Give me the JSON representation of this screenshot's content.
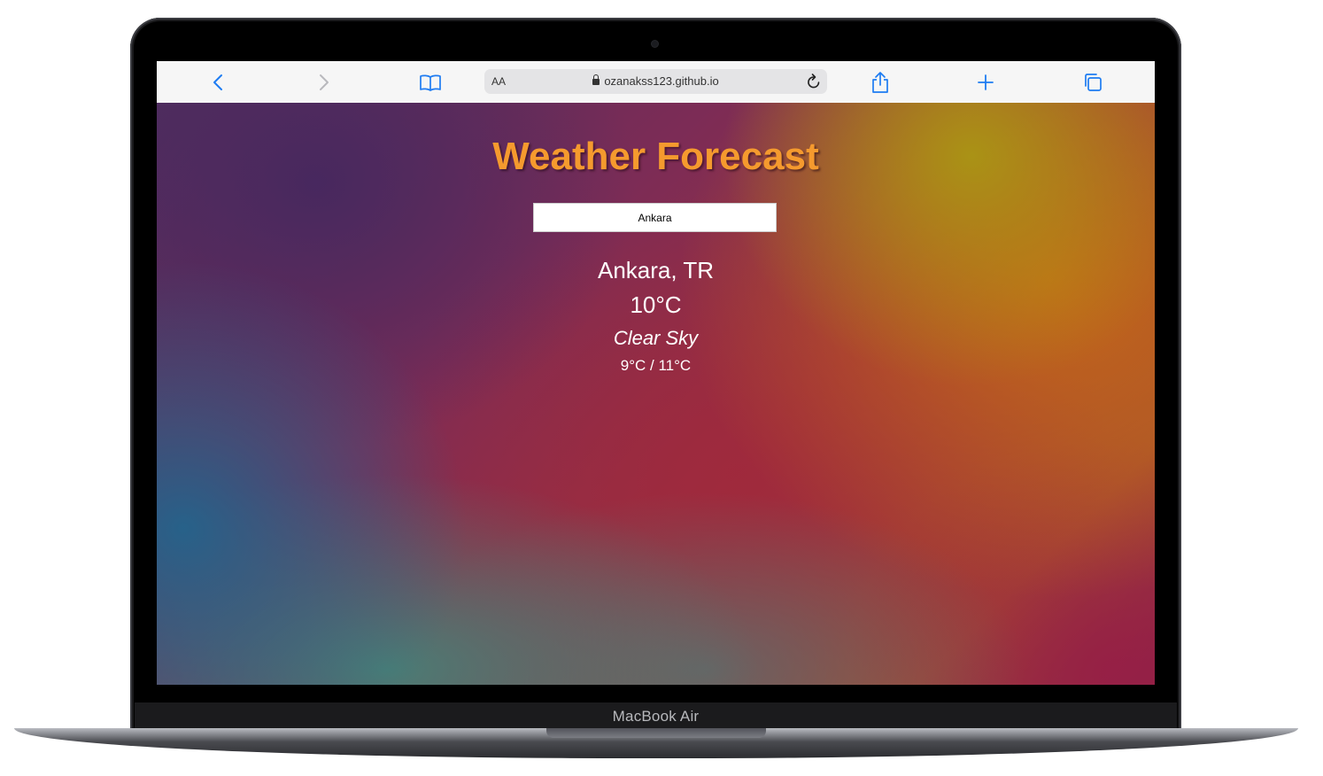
{
  "device": {
    "label": "MacBook Air"
  },
  "browser": {
    "reader_label": "AA",
    "url": "ozanakss123.github.io",
    "accent_color": "#1e7cf2",
    "icons": [
      "back-icon",
      "forward-icon",
      "bookmarks-icon",
      "lock-icon",
      "reload-icon",
      "share-icon",
      "new-tab-icon",
      "tabs-icon"
    ]
  },
  "page": {
    "title": "Weather Forecast",
    "search": {
      "value": "Ankara"
    },
    "weather": {
      "location": "Ankara, TR",
      "temperature": "10°C",
      "description": "Clear Sky",
      "min_max": "9°C / 11°C"
    },
    "colors": {
      "title": "#f59a2e",
      "text": "#ffffff"
    }
  }
}
